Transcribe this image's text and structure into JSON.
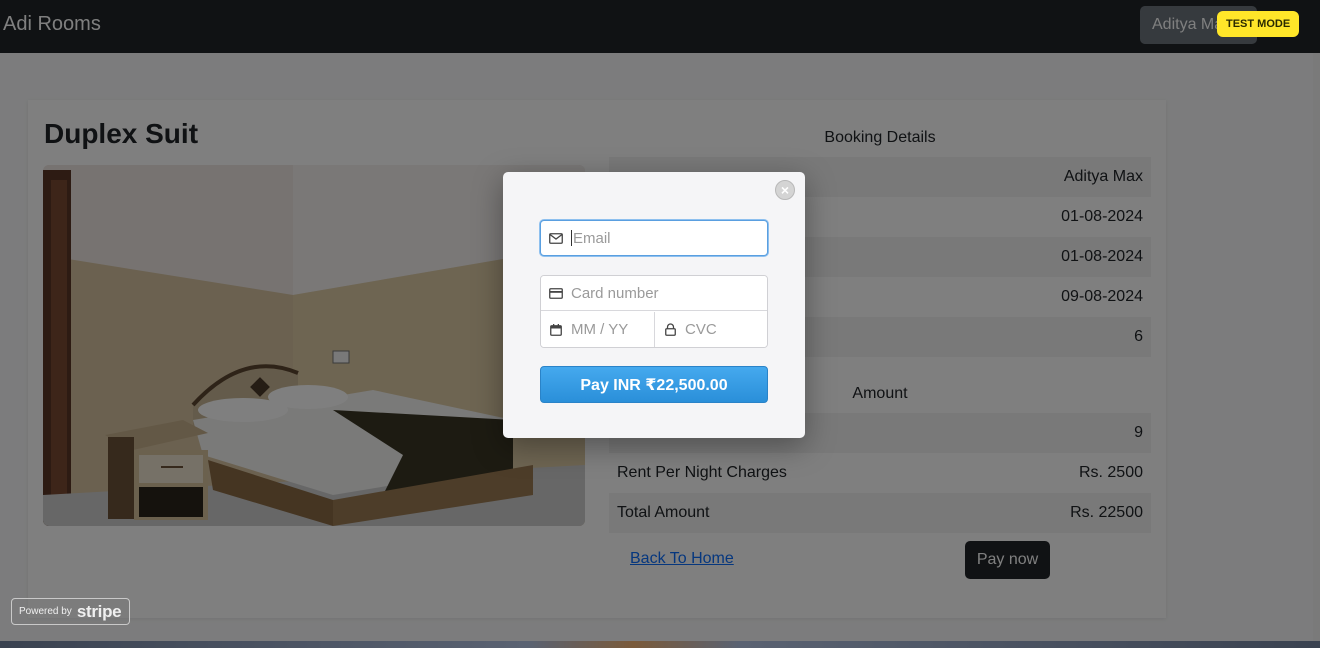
{
  "navbar": {
    "brand": "Adi Rooms",
    "user": "Aditya Max"
  },
  "room": {
    "title": "Duplex Suit"
  },
  "booking": {
    "heading": "Booking Details",
    "rows": [
      {
        "label": "",
        "value": "Aditya Max"
      },
      {
        "label": "",
        "value": "01-08-2024"
      },
      {
        "label": "",
        "value": "01-08-2024"
      },
      {
        "label": "",
        "value": "09-08-2024"
      },
      {
        "label": "",
        "value": "6"
      }
    ]
  },
  "amount": {
    "heading": "Amount",
    "rows": [
      {
        "label": "",
        "value": "9"
      },
      {
        "label": "Rent Per Night Charges",
        "value": "Rs. 2500"
      },
      {
        "label": "Total Amount",
        "value": "Rs. 22500"
      }
    ]
  },
  "actions": {
    "back_home": "Back To Home",
    "pay_now": "Pay now"
  },
  "stripe": {
    "test_mode": "TEST MODE",
    "email_placeholder": "Email",
    "card_number_placeholder": "Card number",
    "expiry_placeholder": "MM / YY",
    "cvc_placeholder": "CVC",
    "pay_button": "Pay INR ₹22,500.00",
    "close_glyph": "×",
    "powered_by": "Powered by",
    "powered_logo": "stripe"
  },
  "icons": [
    "close-icon",
    "mail-icon",
    "credit-card-icon",
    "calendar-icon",
    "lock-icon"
  ]
}
